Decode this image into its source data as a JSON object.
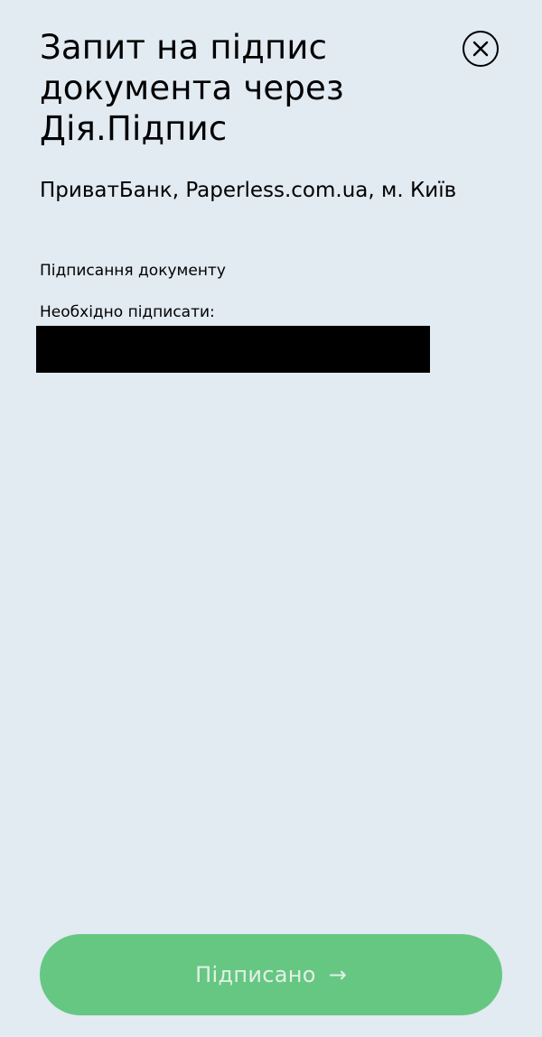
{
  "header": {
    "title": "Запит на підпис документа через Дія.Підпис",
    "close_icon": "close-icon"
  },
  "content": {
    "organization": "ПриватБанк, Paperless.com.ua, м. Київ",
    "document_type": "Підписання документу",
    "need_to_sign_label": "Необхідно підписати:"
  },
  "footer": {
    "sign_button_label": "Підписано",
    "sign_button_icon": "arrow-right-icon",
    "sign_button_color": "#66c782"
  },
  "colors": {
    "background": "#e2eaf2",
    "text": "#000000",
    "accent": "#66c782"
  }
}
